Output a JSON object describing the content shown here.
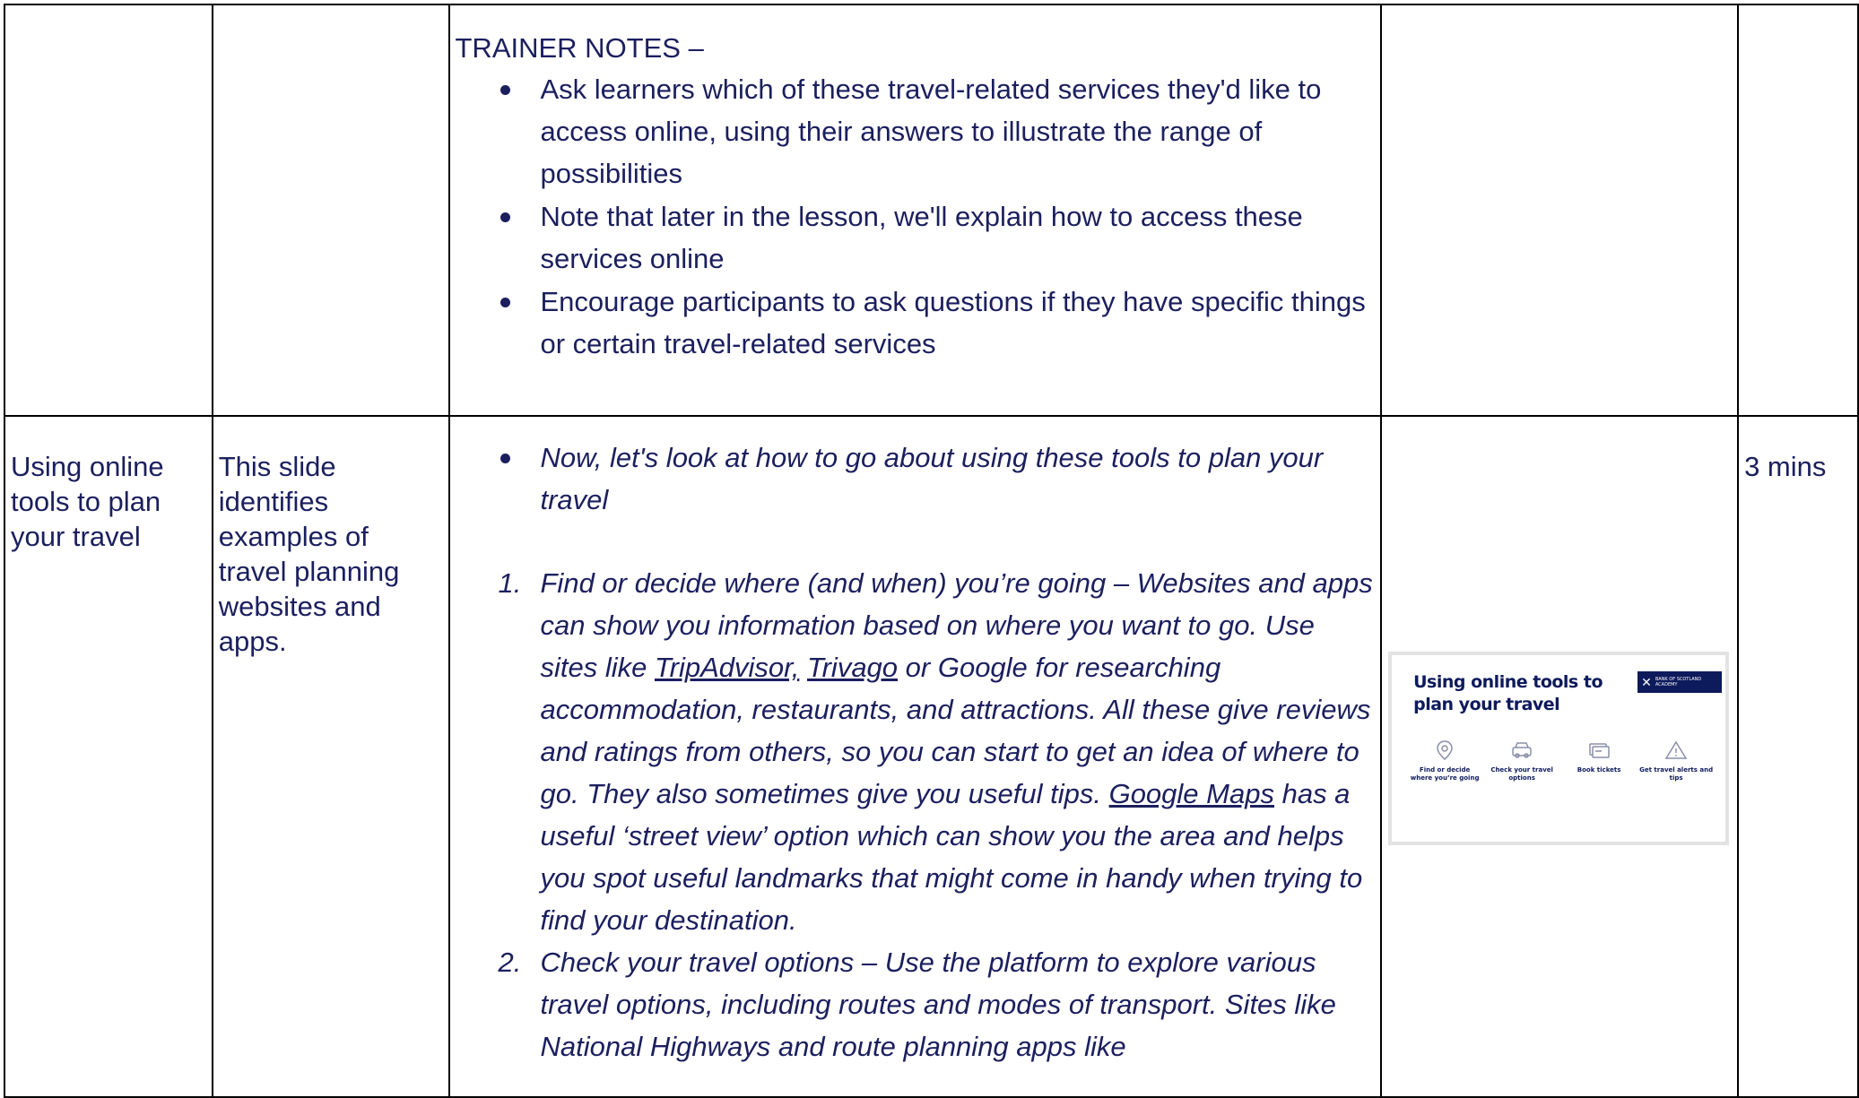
{
  "row1": {
    "notes_heading": "TRAINER NOTES –",
    "bullets": [
      "Ask learners which of these travel-related services they'd like to access online, using their answers to illustrate the range of possibilities",
      "Note that later in the lesson, we'll explain how to access these services online",
      "Encourage participants to ask questions if they have specific things or certain travel-related services"
    ]
  },
  "row2": {
    "topic": "Using online tools to plan your travel",
    "description": "This slide identifies examples of travel planning websites and apps.",
    "intro_bullet": "Now, let's look at how to go about using these tools to plan your travel",
    "item1": {
      "number": "1.",
      "text_a": "Find or decide where (and when) you’re going – Websites and apps can show you information based on where you want to go. Use sites like ",
      "link_tripadvisor": "TripAdvisor,",
      "sep": " ",
      "link_trivago": "Trivago",
      "text_b": " or Google for researching accommodation, restaurants, and attractions. All these give reviews and ratings from others, so you can start to get an idea of where to go. They also sometimes give you useful tips. ",
      "link_maps": "Google Maps",
      "text_c": " has a useful ‘street view’ option which can show you the area and helps you spot useful landmarks that might come in handy when trying to find your destination."
    },
    "item2": {
      "number": "2.",
      "text": "Check your travel options – Use the platform to explore various travel options, including routes and modes of transport. Sites like National Highways  and route planning apps like"
    },
    "duration": "3 mins",
    "slide": {
      "title": "Using online tools to plan your travel",
      "logo_text": "BANK OF SCOTLAND ACADEMY",
      "items": [
        {
          "icon": "location-pin-icon",
          "label": "Find or decide where you’re going"
        },
        {
          "icon": "car-icon",
          "label": "Check your travel options"
        },
        {
          "icon": "ticket-icon",
          "label": "Book tickets"
        },
        {
          "icon": "warning-icon",
          "label": "Get travel alerts and tips"
        }
      ]
    }
  },
  "colors": {
    "text": "#1b1f5e",
    "border": "#000000",
    "slide_navy": "#0d1a5c"
  }
}
